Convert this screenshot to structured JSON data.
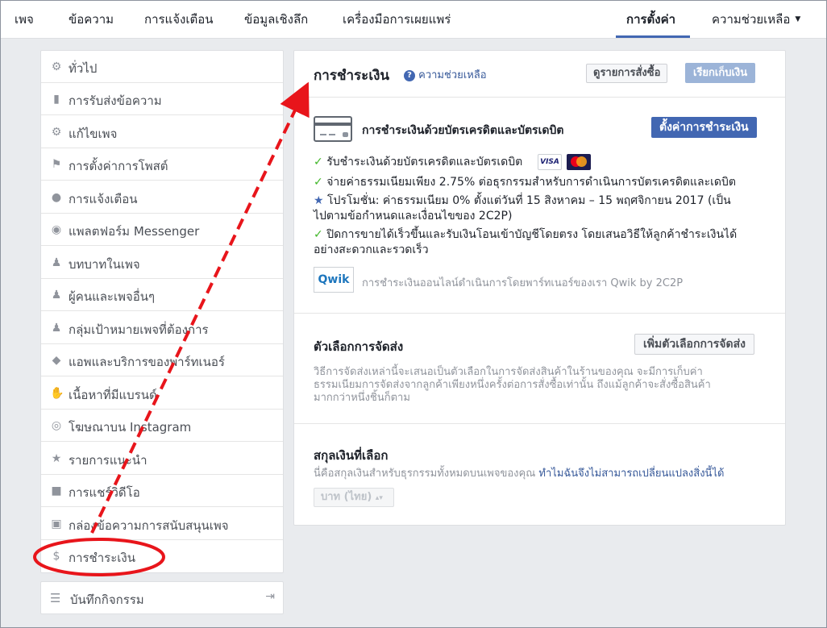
{
  "topnav": {
    "page": "เพจ",
    "messages": "ข้อความ",
    "notifications": "การแจ้งเตือน",
    "insights": "ข้อมูลเชิงลึก",
    "publishing_tools": "เครื่องมือการเผยแพร่",
    "settings": "การตั้งค่า",
    "help": "ความช่วยเหลือ"
  },
  "sidebar": {
    "items": [
      {
        "label": "ทั่วไป",
        "icon": "gear-icon"
      },
      {
        "label": "การรับส่งข้อความ",
        "icon": "chat-icon"
      },
      {
        "label": "แก้ไขเพจ",
        "icon": "gear-icon"
      },
      {
        "label": "การตั้งค่าการโพสต์",
        "icon": "flag-icon"
      },
      {
        "label": "การแจ้งเตือน",
        "icon": "globe-icon"
      },
      {
        "label": "แพลตฟอร์ม Messenger",
        "icon": "messenger-icon"
      },
      {
        "label": "บทบาทในเพจ",
        "icon": "person-icon"
      },
      {
        "label": "ผู้คนและเพจอื่นๆ",
        "icon": "people-star-icon"
      },
      {
        "label": "กลุ่มเป้าหมายเพจที่ต้องการ",
        "icon": "people-star-icon"
      },
      {
        "label": "แอพและบริการของพาร์ทเนอร์",
        "icon": "cube-icon"
      },
      {
        "label": "เนื้อหาที่มีแบรนด์",
        "icon": "handshake-icon"
      },
      {
        "label": "โฆษณาบน Instagram",
        "icon": "instagram-icon"
      },
      {
        "label": "รายการแนะนำ",
        "icon": "star-icon"
      },
      {
        "label": "การแชร์วิดีโอ",
        "icon": "video-icon"
      },
      {
        "label": "กล่องข้อความการสนับสนุนเพจ",
        "icon": "facebook-icon"
      },
      {
        "label": "การชำระเงิน",
        "icon": "dollar-icon"
      }
    ],
    "activity_log": "บันทึกกิจกรรม"
  },
  "payment": {
    "title": "การชำระเงิน",
    "help": "ความช่วยเหลือ",
    "view_orders": "ดูรายการสั่งซื้อ",
    "collect": "เรียกเก็บเงิน",
    "card_title": "การชำระเงินด้วยบัตรเครดิตและบัตรเดบิต",
    "setup_button": "ตั้งค่าการชำระเงิน",
    "bullet1": "รับชำระเงินด้วยบัตรเครดิตและบัตรเดบิต",
    "visa": "VISA",
    "bullet2": "จ่ายค่าธรรมเนียมเพียง 2.75% ต่อธุรกรรมสำหรับการดำเนินการบัตรเครดิตและเดบิต",
    "bullet3_line1": "โปรโมชั่น: ค่าธรรมเนียม 0% ตั้งแต่วันที่ 15 สิงหาคม – 15 พฤศจิกายน 2017 (เป็น",
    "bullet3_line2": "ไปตามข้อกำหนดและเงื่อนไขของ 2C2P)",
    "bullet4_line1": "ปิดการขายได้เร็วขึ้นและรับเงินโอนเข้าบัญชีโดยตรง โดยเสนอวิธีให้ลูกค้าชำระเงินได้",
    "bullet4_line2": "อย่างสะดวกและรวดเร็ว",
    "qwik_logo": "Qwik",
    "partner_note": "การชำระเงินออนไลน์ดำเนินการโดยพาร์ทเนอร์ของเรา Qwik by 2C2P"
  },
  "shipping": {
    "title": "ตัวเลือกการจัดส่ง",
    "add_button": "เพิ่มตัวเลือกการจัดส่ง",
    "desc_line1": "วิธีการจัดส่งเหล่านี้จะเสนอเป็นตัวเลือกในการจัดส่งสินค้าในร้านของคุณ จะมีการเก็บค่า",
    "desc_line2": "ธรรมเนียมการจัดส่งจากลูกค้าเพียงหนึ่งครั้งต่อการสั่งซื้อเท่านั้น ถึงแม้ลูกค้าจะสั่งซื้อสินค้า",
    "desc_line3": "มากกว่าหนึ่งชิ้นก็ตาม"
  },
  "currency": {
    "title": "สกุลเงินที่เลือก",
    "desc": "นี่คือสกุลเงินสำหรับธุรกรรมทั้งหมดบนเพจของคุณ",
    "link": "ทำไมฉันจึงไม่สามารถเปลี่ยนแปลงสิ่งนี้ได้",
    "selected": "บาท (ไทย)"
  },
  "colors": {
    "accent": "#4267b2",
    "check": "#42b72a",
    "annotation": "#e8151b"
  }
}
